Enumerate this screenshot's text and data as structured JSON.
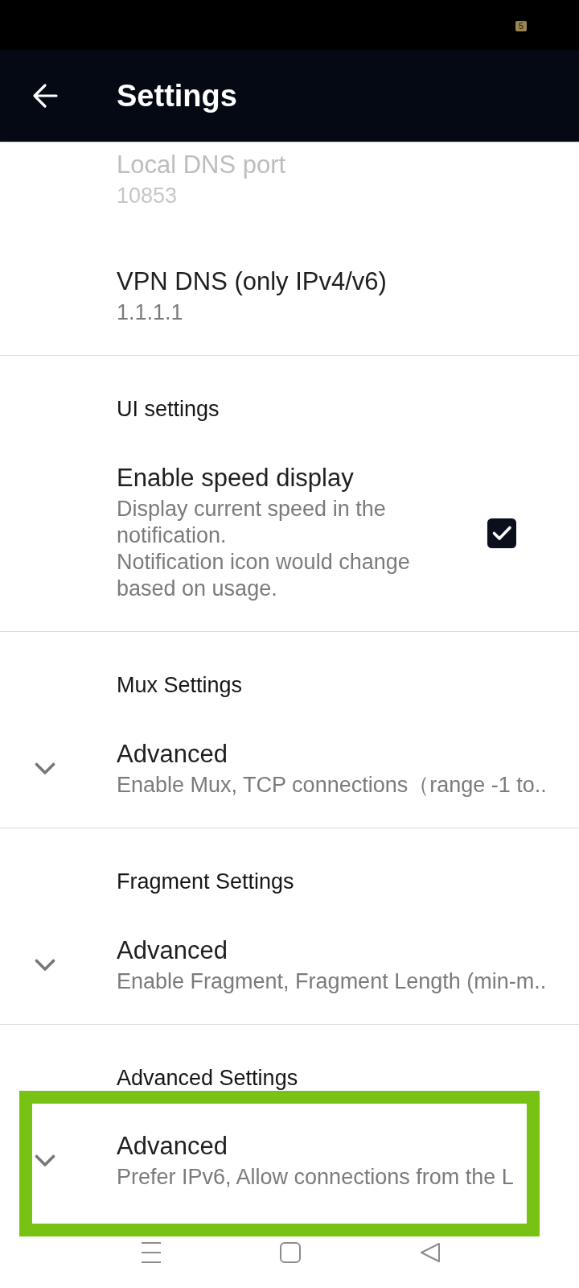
{
  "status_bar": {
    "badge": "5"
  },
  "app_bar": {
    "title": "Settings"
  },
  "sections": [
    {
      "items": [
        {
          "kind": "text",
          "title": "Local DNS port",
          "summary": "10853",
          "disabled": true
        },
        {
          "kind": "text",
          "title": "VPN DNS (only IPv4/v6)",
          "summary": "1.1.1.1",
          "disabled": false
        }
      ]
    },
    {
      "header": "UI settings",
      "items": [
        {
          "kind": "checkbox",
          "title": "Enable speed display",
          "summary": "Display current speed in the notification.\nNotification icon would change based on usage.",
          "checked": true,
          "disabled": false
        }
      ]
    },
    {
      "header": "Mux Settings",
      "items": [
        {
          "kind": "expandable",
          "title": "Advanced",
          "summary": "Enable Mux, TCP connections（range -1 to..",
          "expanded": false,
          "disabled": false
        }
      ]
    },
    {
      "header": "Fragment Settings",
      "items": [
        {
          "kind": "expandable",
          "title": "Advanced",
          "summary": "Enable Fragment, Fragment Length (min-m..",
          "expanded": false,
          "disabled": false
        }
      ]
    },
    {
      "header": "Advanced Settings",
      "items": [
        {
          "kind": "expandable",
          "title": "Advanced",
          "summary": "Prefer IPv6, Allow connections from the L",
          "expanded": false,
          "disabled": false,
          "highlighted": true
        }
      ]
    }
  ]
}
